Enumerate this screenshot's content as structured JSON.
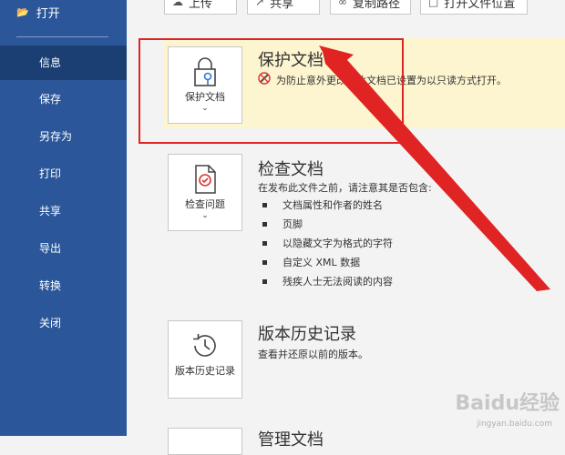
{
  "sidebar": {
    "open_label": "打开",
    "items": [
      "信息",
      "保存",
      "另存为",
      "打印",
      "共享",
      "导出",
      "转换",
      "关闭"
    ]
  },
  "toolbar": {
    "upload": "上传",
    "share": "共享",
    "copy_path": "复制路径",
    "open_location": "打开文件位置"
  },
  "protect": {
    "tile_label": "保护文档",
    "title": "保护文档",
    "note": "为防止意外更改，此文档已设置为以只读方式打开。"
  },
  "inspect": {
    "tile_label": "检查问题",
    "title": "检查文档",
    "desc": "在发布此文件之前，请注意其是否包含:",
    "bullets": [
      "文档属性和作者的姓名",
      "页脚",
      "以隐藏文字为格式的字符",
      "自定义 XML 数据",
      "残疾人士无法阅读的内容"
    ]
  },
  "version": {
    "tile_label": "版本历史记录",
    "title": "版本历史记录",
    "desc": "查看并还原以前的版本。"
  },
  "manage": {
    "title": "管理文档"
  },
  "watermark": {
    "brand": "Baidu经验",
    "url": "jingyan.baidu.com"
  },
  "colors": {
    "sidebar": "#2b579a",
    "active": "#1b3f73",
    "highlight": "#fdf5d0",
    "annotation": "#e02424"
  }
}
